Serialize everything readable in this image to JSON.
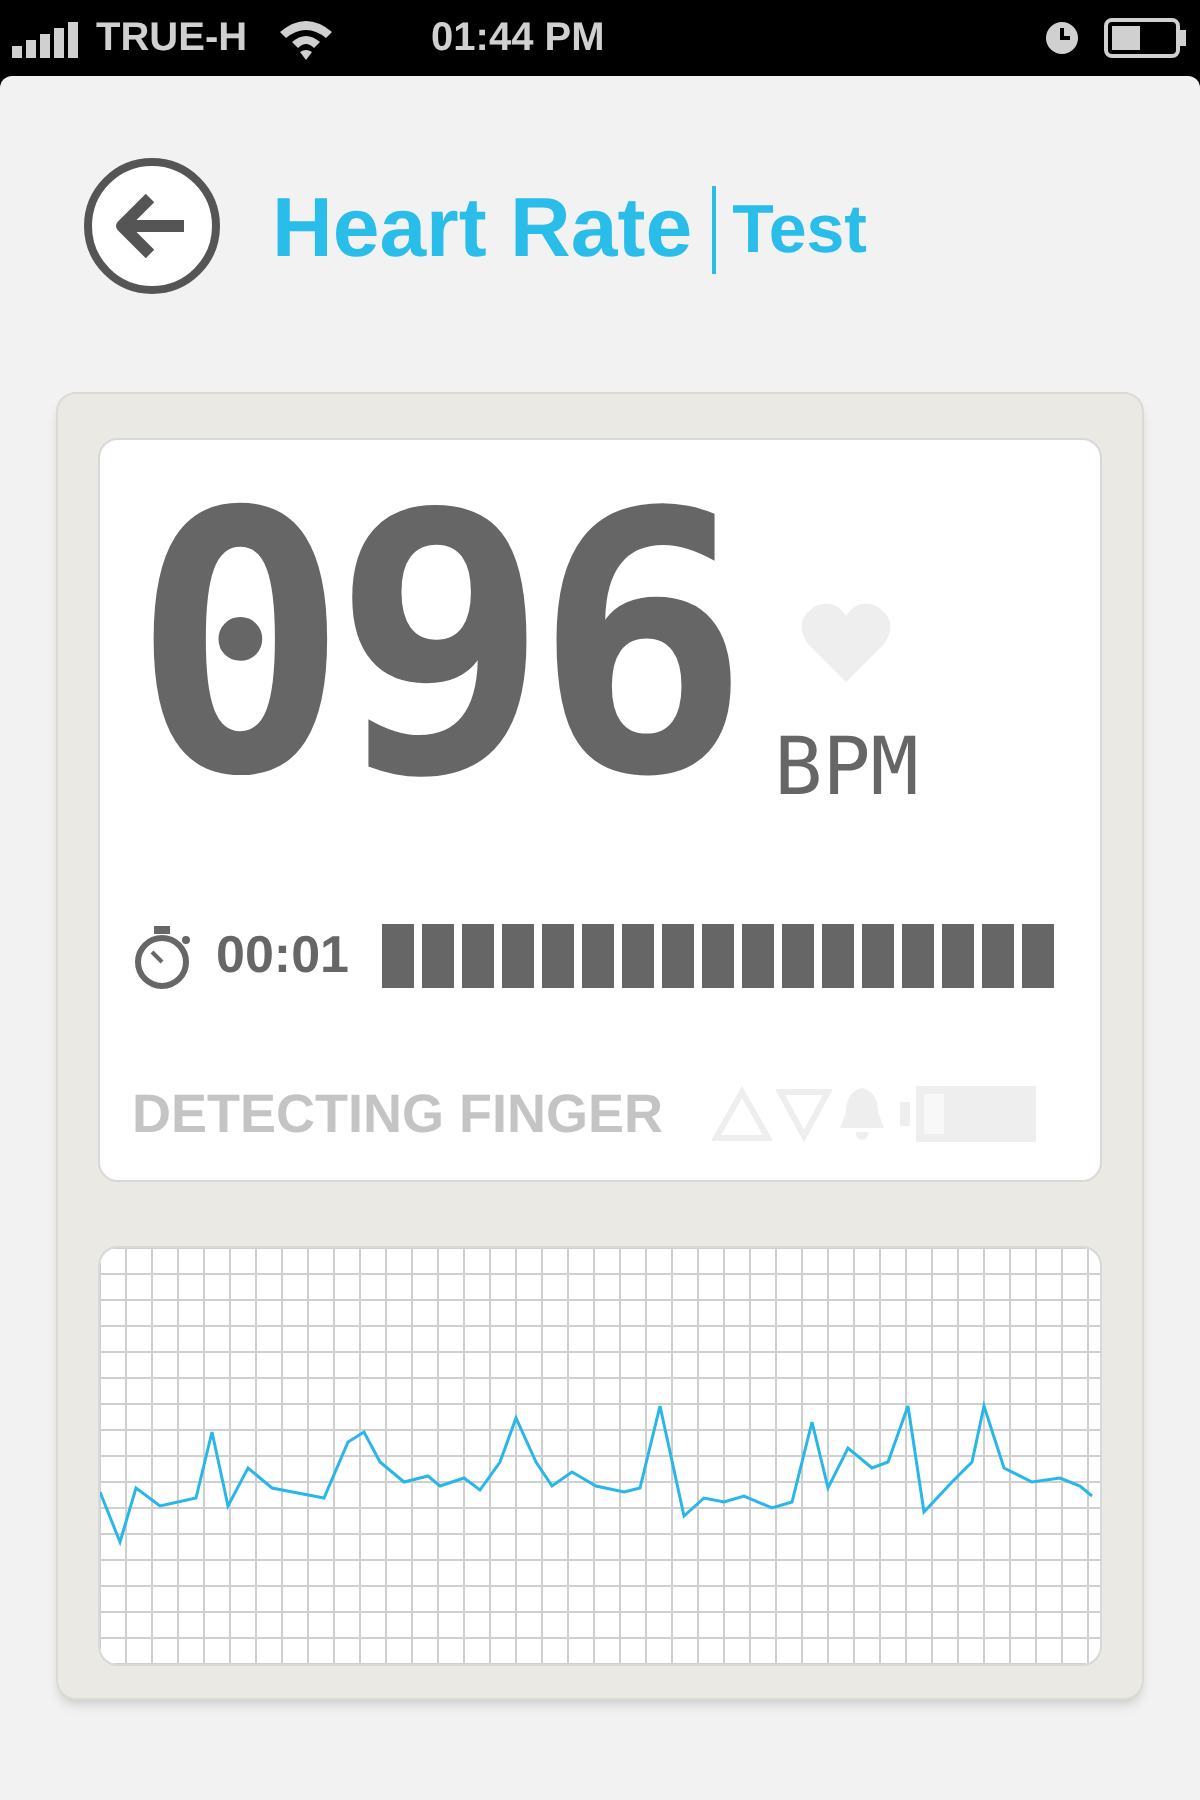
{
  "status_bar": {
    "carrier": "TRUE-H",
    "time": "01:44 PM"
  },
  "header": {
    "title": "Heart Rate",
    "subtitle": "Test"
  },
  "display": {
    "reading": "096",
    "unit": "BPM",
    "heart_on": false,
    "timer": "00:01",
    "status": {
      "text": "DETECTING FINGER",
      "active": false
    },
    "alarm_high": false,
    "alarm_low": false,
    "alarm_bell": false,
    "battery_on": false
  },
  "ecg": {
    "kind": "waveform"
  }
}
